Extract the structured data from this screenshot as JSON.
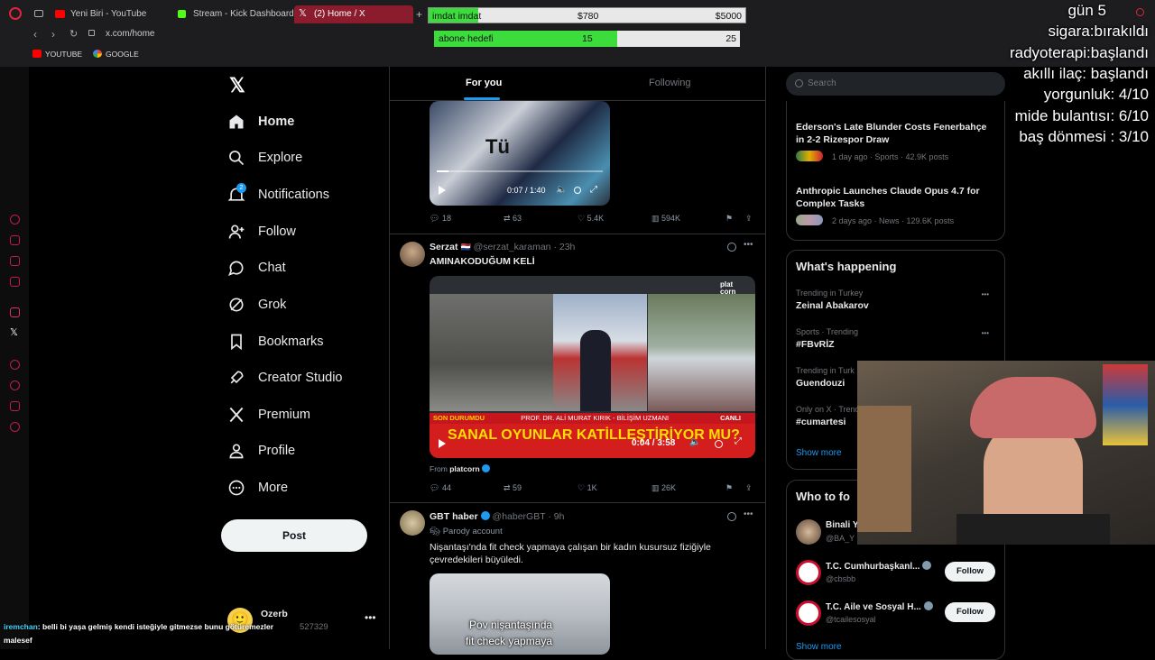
{
  "browser": {
    "tabs": [
      {
        "label": "Yeni Biri - YouTube",
        "icon": "youtube-icon",
        "color": "#ff0000"
      },
      {
        "label": "Stream - Kick Dashboard",
        "icon": "kick-icon",
        "color": "#53fc18"
      },
      {
        "label": "(2) Home / X",
        "icon": "x-icon",
        "color": "#ffffff",
        "active": true
      }
    ],
    "url": "x.com/home",
    "bookmarks": [
      {
        "label": "YOUTUBE",
        "icon": "youtube-icon",
        "color": "#ff0000"
      },
      {
        "label": "GOOGLE",
        "icon": "google-icon",
        "color": "#4285f4"
      }
    ]
  },
  "nav": {
    "items": [
      {
        "label": "Home",
        "icon": "home-icon",
        "active": true
      },
      {
        "label": "Explore",
        "icon": "search-icon"
      },
      {
        "label": "Notifications",
        "icon": "bell-icon",
        "badge": "2"
      },
      {
        "label": "Follow",
        "icon": "add-person-icon"
      },
      {
        "label": "Chat",
        "icon": "chat-icon"
      },
      {
        "label": "Grok",
        "icon": "grok-icon"
      },
      {
        "label": "Bookmarks",
        "icon": "bookmark-icon"
      },
      {
        "label": "Creator Studio",
        "icon": "rocket-icon"
      },
      {
        "label": "Premium",
        "icon": "x-icon"
      },
      {
        "label": "Profile",
        "icon": "person-icon"
      },
      {
        "label": "More",
        "icon": "more-circle-icon"
      }
    ],
    "post_label": "Post",
    "account": {
      "name": "Ozerb",
      "handle": "527329"
    }
  },
  "feed": {
    "tabs": {
      "for_you": "For you",
      "following": "Following"
    },
    "post1": {
      "video_time": "0:07 / 1:40",
      "replies": "18",
      "reposts": "63",
      "likes": "5.4K",
      "views": "594K"
    },
    "post2": {
      "author": "Serzat",
      "flag": "🇳🇱",
      "handle": "@serzat_karaman",
      "time": "23h",
      "text": "AMINAKODUĞUM KELİ",
      "video_time": "0:04 / 3:58",
      "tv_headline": "SANAL OYUNLAR KATİLLEŞTİRİYOR MU?",
      "tv_ticker_left": "SON DURUMDU",
      "tv_ticker_right": "PROF. DR. ALİ MURAT KIRIK - BİLİŞİM UZMANI",
      "tv_live": "CANLI",
      "from_label": "From",
      "from_source": "platcorn",
      "replies": "44",
      "reposts": "59",
      "likes": "1K",
      "views": "26K"
    },
    "post3": {
      "author": "GBT haber",
      "handle": "@haberGBT",
      "time": "9h",
      "parody": "Parody account",
      "text": "Nişantaşı'nda fit check yapmaya çalışan bir kadın kusursuz fiziğiyle çevredekileri büyüledi.",
      "caption_line1": "Pov nişantaşında",
      "caption_line2": "fit check yapmaya"
    }
  },
  "right": {
    "search_placeholder": "Search",
    "news": [
      {
        "title": "Ederson's Late Blunder Costs Fenerbahçe in 2-2 Rizespor Draw",
        "meta": "1 day ago · Sports · 42.9K posts"
      },
      {
        "title": "Anthropic Launches Claude Opus 4.7 for Complex Tasks",
        "meta": "2 days ago · News · 129.6K posts"
      }
    ],
    "happening_title": "What's happening",
    "trends": [
      {
        "context": "Trending in Turkey",
        "name": "Zeinal Abakarov"
      },
      {
        "context": "Sports · Trending",
        "name": "#FBvRİZ"
      },
      {
        "context": "Trending in Turk",
        "name": "Guendouzi"
      },
      {
        "context": "Only on X · Trend",
        "name": "#cumartesi"
      }
    ],
    "show_more": "Show more",
    "who_to_follow": "Who to fo",
    "suggestions": [
      {
        "name": "Binali Y",
        "handle": "@BA_Y"
      },
      {
        "name": "T.C. Cumhurbaşkanl...",
        "handle": "@cbsbb",
        "button": "Follow"
      },
      {
        "name": "T.C. Aile ve Sosyal H...",
        "handle": "@tcailesosyal",
        "button": "Follow"
      }
    ],
    "show_more_bottom": "Show more"
  },
  "stream": {
    "overlay_lines": [
      "gün 5",
      "sigara:bırakıldı",
      "radyoterapi:başlandı",
      "akıllı ilaç: başlandı",
      "yorgunluk:  4/10",
      "mide bulantısı: 6/10",
      "baş dönmesi : 3/10"
    ],
    "donation_bar": {
      "label": "imdat imdat",
      "current": "$780",
      "goal": "$5000",
      "progress": 0.156
    },
    "sub_bar": {
      "label": "abone hedefi",
      "current": "15",
      "goal": "25",
      "progress": 0.6
    },
    "chat": [
      {
        "user": "iremchan",
        "text": ": belli bi yaşa gelmiş kendi isteğiyle gitmezse bunu götüremezler"
      },
      {
        "user": "",
        "text": "malesef"
      }
    ]
  },
  "colors": {
    "accent": "#1d9bf0",
    "verified": "#1d9bf0",
    "bar_green": "#3ddc3d",
    "tab_active": "#8a1c2e"
  }
}
